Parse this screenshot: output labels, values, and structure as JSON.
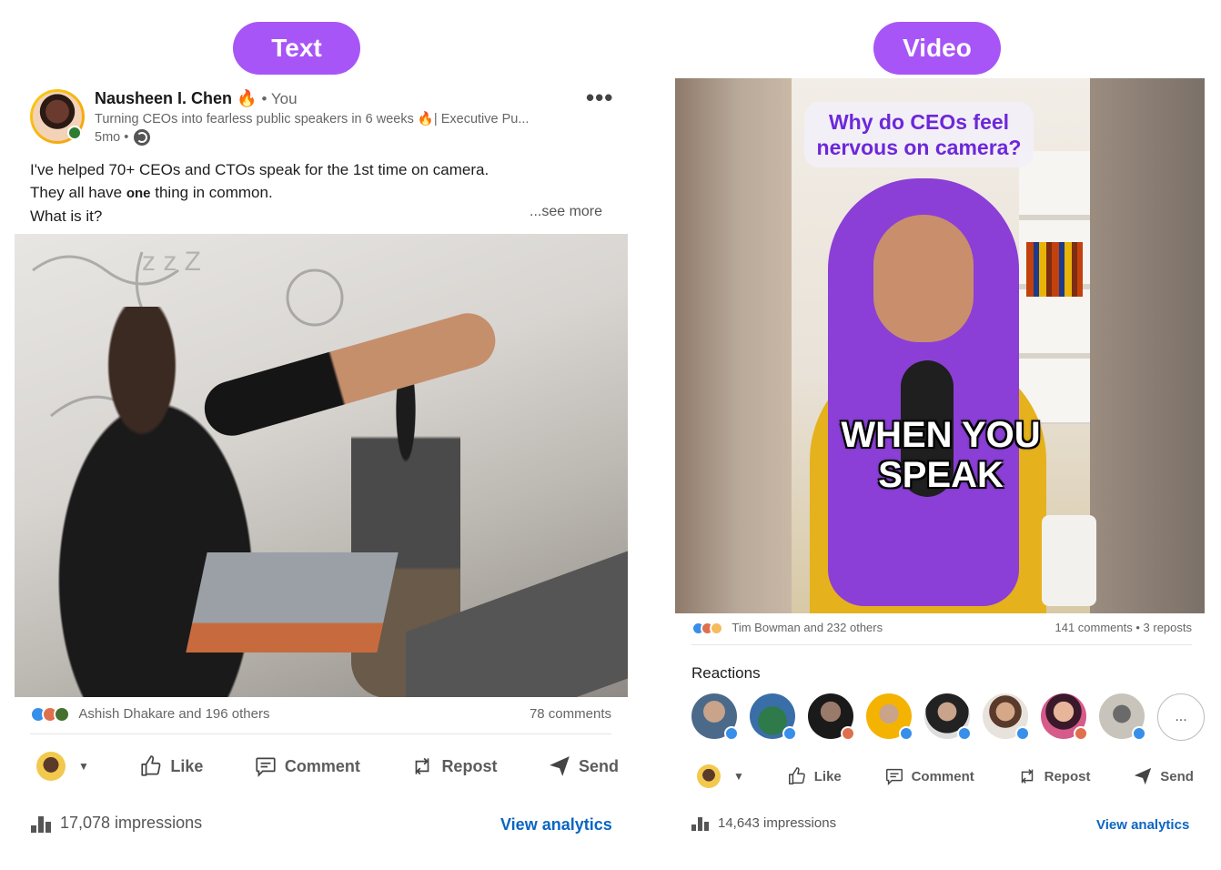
{
  "labels": {
    "left_pill": "Text",
    "right_pill": "Video"
  },
  "text_post": {
    "author_name": "Nausheen I. Chen",
    "author_emoji": "🔥",
    "author_you": "• You",
    "headline": "Turning CEOs into fearless public speakers in 6 weeks 🔥| Executive Pu...",
    "time": "5mo •",
    "more_menu": "•••",
    "body_line1": "I've helped 70+ CEOs and CTOs speak for the 1st time on camera.",
    "body_line2_a": "They all have ",
    "body_line2_bold": "one",
    "body_line2_b": " thing in common.",
    "body_line3": "What is it?",
    "see_more": "...see more",
    "reactions_text": "Ashish Dhakare and 196 others",
    "comments": "78 comments",
    "actions": {
      "like": "Like",
      "comment": "Comment",
      "repost": "Repost",
      "send": "Send"
    },
    "impressions": "17,078 impressions",
    "view_analytics": "View analytics"
  },
  "video_post": {
    "question_overlay": "Why do CEOs feel nervous on camera?",
    "caption_overlay_line1": "WHEN YOU",
    "caption_overlay_line2": "SPEAK",
    "reactions_text": "Tim Bowman and 232 others",
    "comments_reposts": "141 comments • 3 reposts",
    "reactions_title": "Reactions",
    "more_reactors": "...",
    "actions": {
      "like": "Like",
      "comment": "Comment",
      "repost": "Repost",
      "send": "Send"
    },
    "impressions": "14,643 impressions",
    "view_analytics": "View analytics"
  },
  "colors": {
    "pill": "#a855f7",
    "link": "#0a66c2",
    "question_text": "#6d28d9",
    "hair": "#8b3fd6"
  },
  "icons": [
    "like-icon",
    "comment-icon",
    "repost-icon",
    "send-icon",
    "analytics-bars-icon",
    "globe-icon",
    "more-dots-icon"
  ]
}
